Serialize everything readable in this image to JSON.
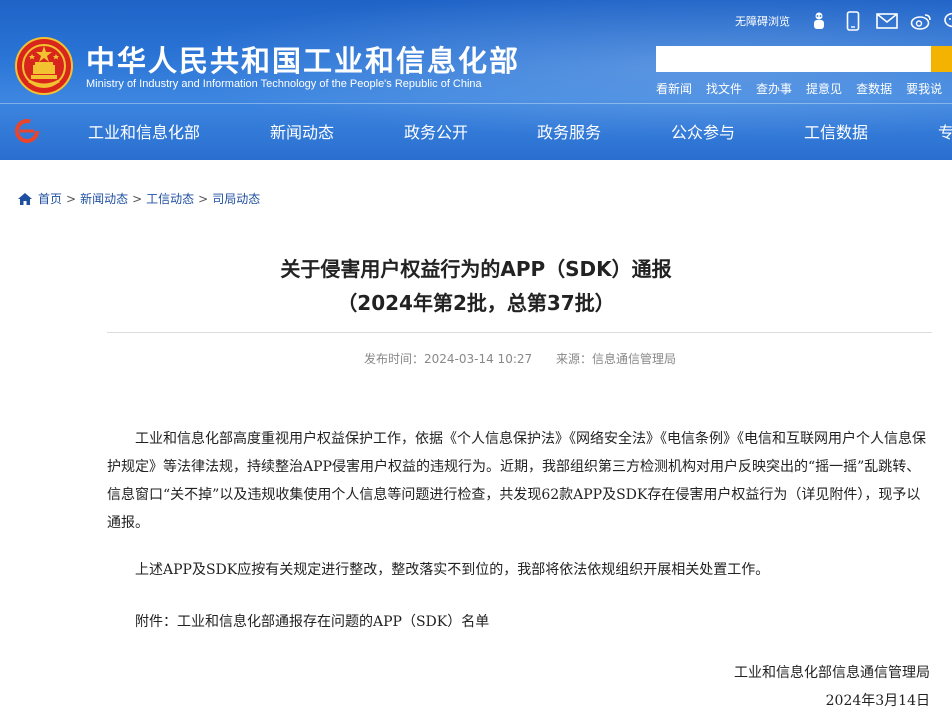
{
  "header": {
    "site_name_cn": "中华人民共和国工业和信息化部",
    "site_name_en": "Ministry of Industry and Information Technology of the People's Republic of China",
    "barrier_free": "无障碍浏览",
    "top_icons": [
      "robot-icon",
      "mobile-icon",
      "mail-icon",
      "weibo-icon",
      "wechat-icon"
    ],
    "search_placeholder": "",
    "quick_links": [
      "看新闻",
      "找文件",
      "查办事",
      "提意见",
      "查数据",
      "要我说"
    ]
  },
  "nav": {
    "items": [
      "工业和信息化部",
      "新闻动态",
      "政务公开",
      "政务服务",
      "公众参与",
      "工信数据",
      "专"
    ]
  },
  "breadcrumb": {
    "items": [
      "首页",
      "新闻动态",
      "工信动态",
      "司局动态"
    ],
    "separator": ">"
  },
  "article": {
    "title_line1": "关于侵害用户权益行为的APP（SDK）通报",
    "title_line2": "（2024年第2批，总第37批）",
    "publish_label": "发布时间：2024-03-14 10:27",
    "source_label": "来源：信息通信管理局",
    "paragraphs": [
      "工业和信息化部高度重视用户权益保护工作，依据《个人信息保护法》《网络安全法》《电信条例》《电信和互联网用户个人信息保护规定》等法律法规，持续整治APP侵害用户权益的违规行为。近期，我部组织第三方检测机构对用户反映突出的“摇一摇”乱跳转、信息窗口“关不掉”以及违规收集使用个人信息等问题进行检查，共发现62款APP及SDK存在侵害用户权益行为（详见附件），现予以通报。",
      "上述APP及SDK应按有关规定进行整改，整改落实不到位的，我部将依法依规组织开展相关处置工作。",
      "附件：工业和信息化部通报存在问题的APP（SDK）名单"
    ],
    "signature_org": "工业和信息化部信息通信管理局",
    "signature_date": "2024年3月14日"
  },
  "colors": {
    "header_blue": "#2a6fd0",
    "search_button": "#f3b300",
    "link_blue": "#1f4fa0"
  }
}
